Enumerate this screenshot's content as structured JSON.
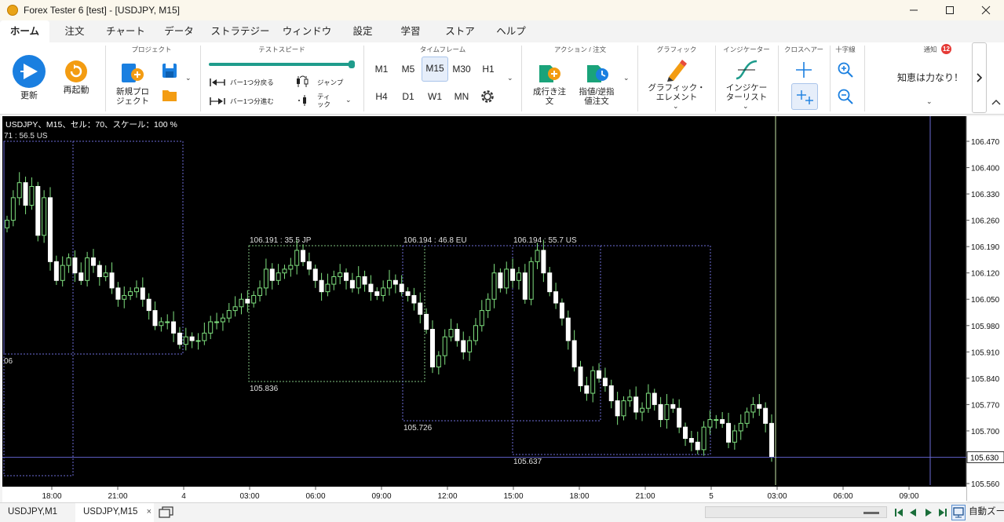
{
  "window": {
    "title": "Forex Tester 6  [test] - [USDJPY, M15]"
  },
  "menu": {
    "tabs": [
      "ホーム",
      "注文",
      "チャート",
      "データ",
      "ストラテジー",
      "ウィンドウ",
      "設定",
      "学習",
      "ストア",
      "ヘルプ"
    ],
    "active": "ホーム"
  },
  "ribbon": {
    "refresh_label": "更新",
    "restart_label": "再起動",
    "project": {
      "group": "プロジェクト",
      "new_line1": "新規プロ",
      "new_line2": "ジェクト"
    },
    "speed": {
      "group": "テストスピード",
      "back_label": "バー1つ分戻る",
      "forward_label": "バー1つ分進む",
      "jump_label": "ジャンプ",
      "tick_line1": "ティ",
      "tick_line2": "ック",
      "slider_percent": 100
    },
    "timeframe": {
      "group": "タイムフレーム",
      "row1": [
        "M1",
        "M5",
        "M15",
        "M30",
        "H1"
      ],
      "row2": [
        "H4",
        "D1",
        "W1",
        "MN"
      ],
      "selected": "M15"
    },
    "action": {
      "group": "アクション / 注文",
      "market_line1": "成行き注",
      "market_line2": "文",
      "limit_line1": "指値/逆指",
      "limit_line2": "値注文"
    },
    "graphic": {
      "group": "グラフィック",
      "line1": "グラフィック・",
      "line2": "エレメント"
    },
    "indicator": {
      "group": "インジケーター",
      "line1": "インジケー",
      "line2": "ターリスト"
    },
    "crosshair": {
      "group": "クロスヘアー"
    },
    "zoom": {
      "group": "十字線"
    },
    "notify": {
      "group": "通知",
      "badge": "12",
      "message": "知恵は力なり！"
    }
  },
  "chart_data": {
    "type": "candlestick",
    "info_text": "USDJPY、M15、セル：70、スケール：100 %",
    "price_ticks": [
      "106.470",
      "106.400",
      "106.330",
      "106.260",
      "106.190",
      "106.120",
      "106.050",
      "105.980",
      "105.910",
      "105.840",
      "105.770",
      "105.700",
      "105.630",
      "105.560"
    ],
    "ylim": [
      105.56,
      106.47
    ],
    "current_price": "105.630",
    "time_ticks": [
      "18:00",
      "21:00",
      "4",
      "03:00",
      "06:00",
      "09:00",
      "12:00",
      "15:00",
      "18:00",
      "21:00",
      "5",
      "03:00",
      "06:00",
      "09:00"
    ],
    "boxes": [
      {
        "top_label": "71 : 56.5 US",
        "bottom_label": "06",
        "high": 106.46,
        "low": 105.9
      },
      {
        "top_label": "106.191 : 35.5 JP",
        "bottom_label": "105.836",
        "high": 106.191,
        "low": 105.836
      },
      {
        "top_label": "106.194 : 46.8 EU",
        "bottom_label": "105.726",
        "high": 106.194,
        "low": 105.726
      },
      {
        "top_label": "106.194 : 55.7 US",
        "bottom_label": "105.637",
        "high": 106.194,
        "low": 105.637
      }
    ],
    "candles_close": [
      106.26,
      106.32,
      106.36,
      106.3,
      106.35,
      106.22,
      106.32,
      106.15,
      106.1,
      106.14,
      106.16,
      106.12,
      106.1,
      106.16,
      106.14,
      106.11,
      106.12,
      106.08,
      106.05,
      106.06,
      106.07,
      106.08,
      106.05,
      106.02,
      105.98,
      105.99,
      105.99,
      105.96,
      105.93,
      105.95,
      105.94,
      105.94,
      105.96,
      105.99,
      105.99,
      106.0,
      106.02,
      106.03,
      106.05,
      106.04,
      106.06,
      106.08,
      106.13,
      106.1,
      106.12,
      106.13,
      106.14,
      106.18,
      106.15,
      106.13,
      106.1,
      106.07,
      106.09,
      106.11,
      106.12,
      106.1,
      106.08,
      106.11,
      106.09,
      106.07,
      106.06,
      106.08,
      106.1,
      106.09,
      106.07,
      106.06,
      106.04,
      106.01,
      105.97,
      105.87,
      105.9,
      105.95,
      105.97,
      105.94,
      105.91,
      105.94,
      105.98,
      106.02,
      106.05,
      106.12,
      106.08,
      106.13,
      106.1,
      106.12,
      106.05,
      106.15,
      106.18,
      106.12,
      106.07,
      106.04,
      106.0,
      105.94,
      105.87,
      105.82,
      105.8,
      105.86,
      105.84,
      105.82,
      105.78,
      105.74,
      105.78,
      105.79,
      105.75,
      105.76,
      105.8,
      105.77,
      105.73,
      105.77,
      105.76,
      105.71,
      105.68,
      105.67,
      105.65,
      105.71,
      105.73,
      105.73,
      105.72,
      105.67,
      105.7,
      105.72,
      105.75,
      105.77,
      105.76,
      105.72,
      105.63
    ]
  },
  "bottom": {
    "tabs": [
      "USDJPY,M1",
      "USDJPY,M15"
    ],
    "active": "USDJPY,M15",
    "close_glyph": "×",
    "autozoom_label": "自動ズーム"
  }
}
